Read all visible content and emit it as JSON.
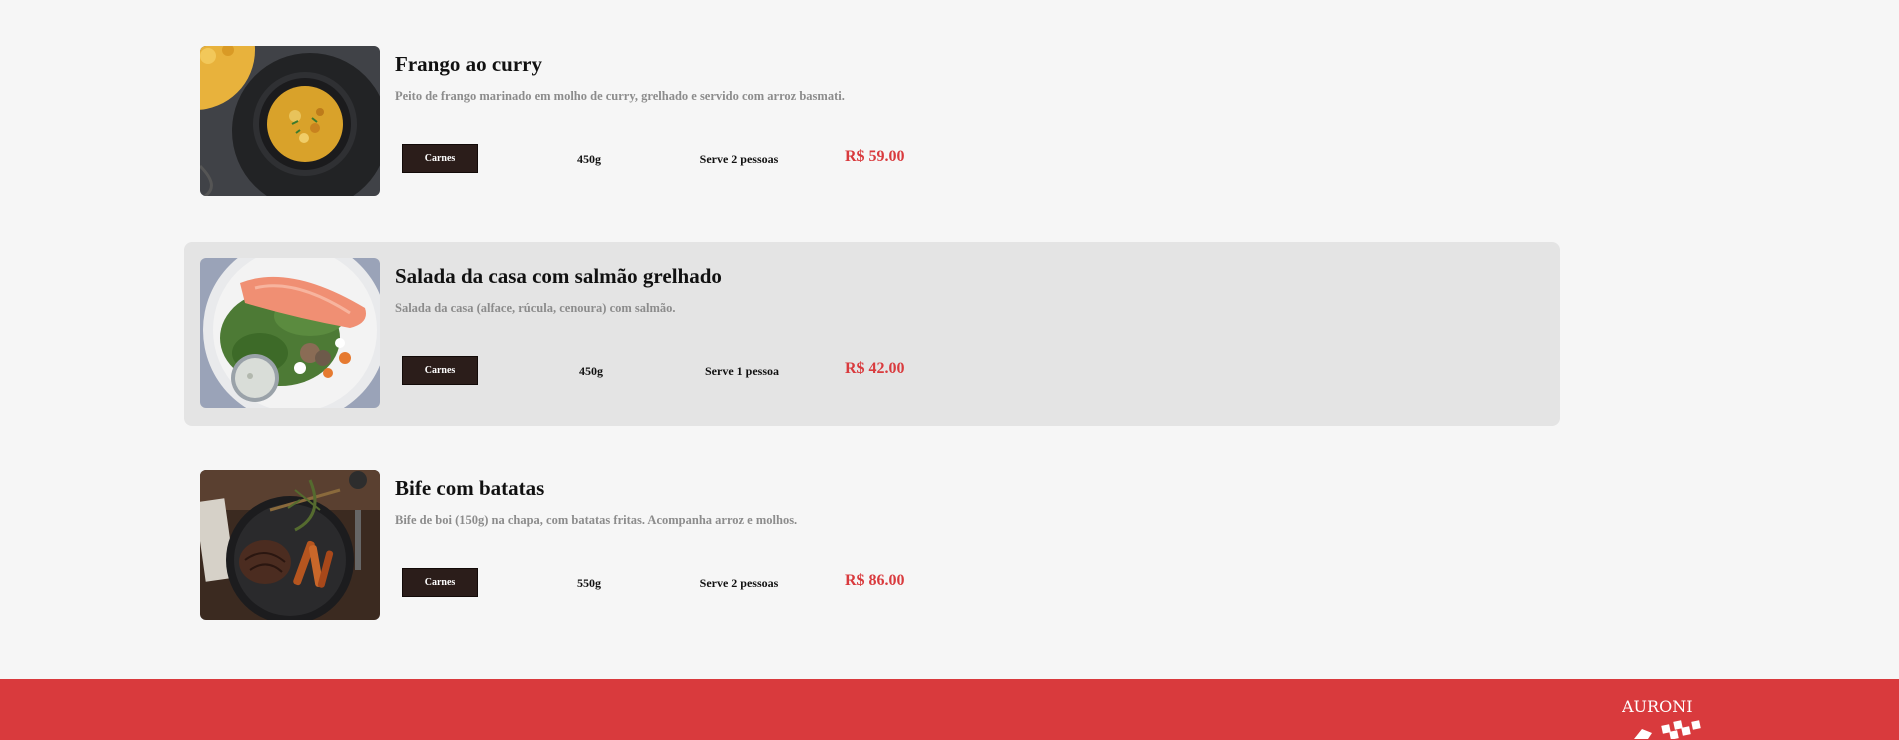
{
  "menu": {
    "items": [
      {
        "title": "Frango ao curry",
        "description": "Peito de frango marinado em molho de curry, grelhado e servido com arroz basmati.",
        "category": "Carnes",
        "weight": "450g",
        "serves": "Serve 2 pessoas",
        "price": "R$ 59.00",
        "image": "chicken-curry-bowl-image"
      },
      {
        "title": "Salada da casa com salmão grelhado",
        "description": "Salada da casa (alface, rúcula, cenoura) com salmão.",
        "category": "Carnes",
        "weight": "450g",
        "serves": "Serve 1 pessoa",
        "price": "R$ 42.00",
        "image": "salmon-salad-plate-image"
      },
      {
        "title": "Bife com batatas",
        "description": "Bife de boi (150g) na chapa, com batatas fritas. Acompanha arroz e molhos.",
        "category": "Carnes",
        "weight": "550g",
        "serves": "Serve 2 pessoas",
        "price": "R$ 86.00",
        "image": "steak-with-potatoes-pan-image"
      }
    ]
  },
  "footer": {
    "logo_text": "AURONI"
  },
  "colors": {
    "accent": "#d93a3d",
    "tag_bg": "#2b1d1a",
    "page_bg": "#f6f6f6",
    "highlight_bg": "#e4e4e4"
  }
}
